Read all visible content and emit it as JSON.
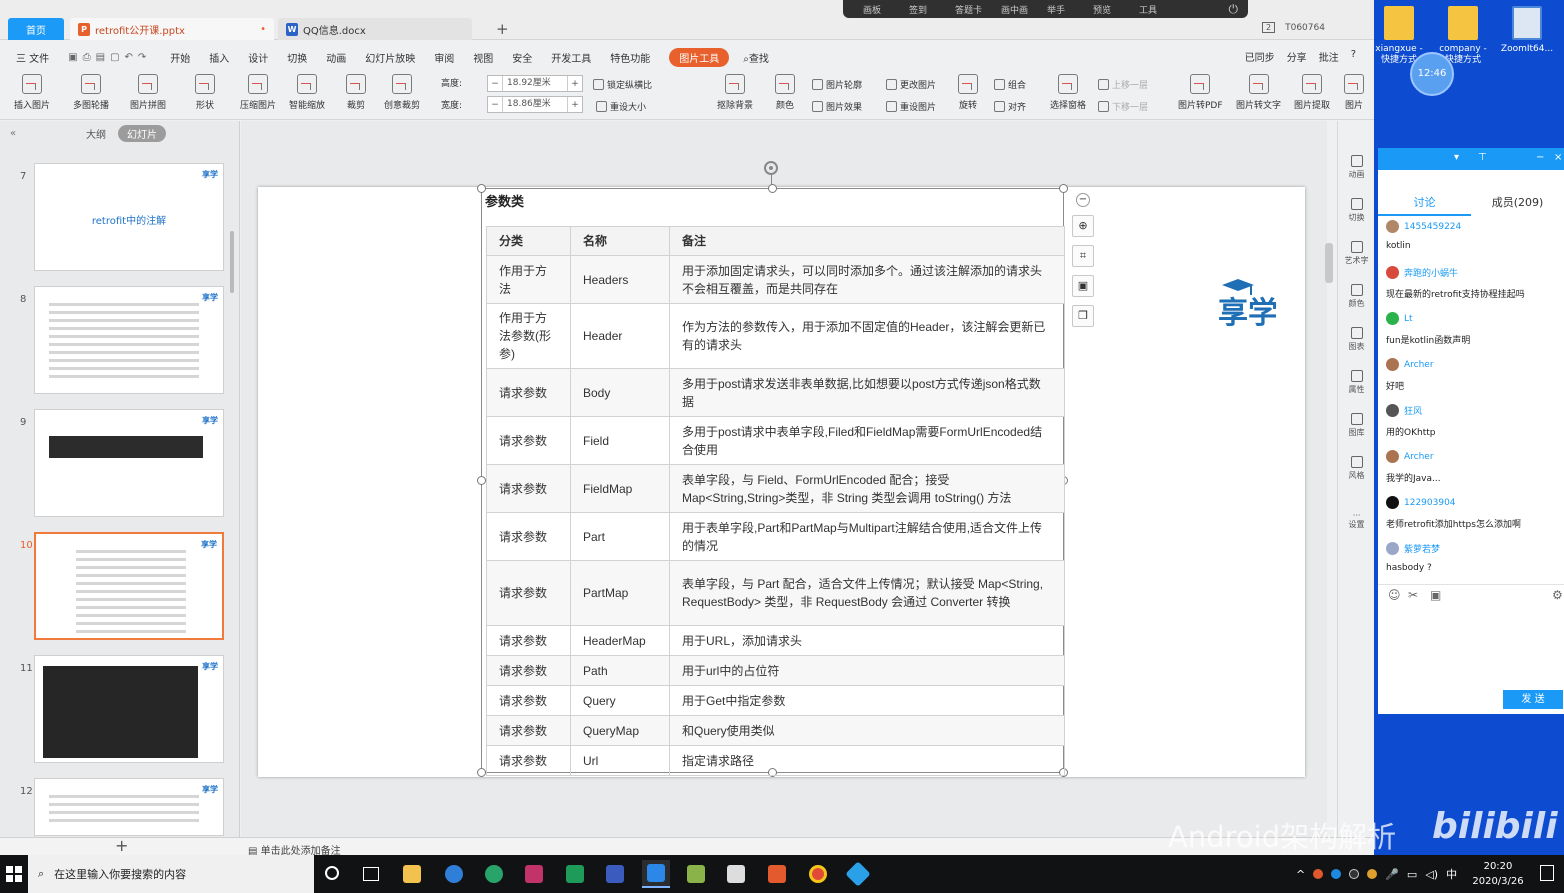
{
  "tabs": [
    {
      "label": "首页"
    },
    {
      "label": "retrofit公开课.pptx",
      "dirty": "•"
    },
    {
      "label": "QQ信息.docx"
    }
  ],
  "remote_bar": [
    "画板",
    "签到",
    "答题卡",
    "画中画",
    "举手",
    "预览",
    "工具"
  ],
  "window_controls": {
    "badge": "2",
    "user": "T060764"
  },
  "menu": {
    "file": "三 文件",
    "items": [
      "开始",
      "插入",
      "设计",
      "切换",
      "动画",
      "幻灯片放映",
      "审阅",
      "视图",
      "安全",
      "开发工具",
      "特色功能"
    ],
    "active": "图片工具",
    "search": "查找",
    "right": [
      "已同步",
      "分享",
      "批注",
      "?"
    ]
  },
  "ribbon": {
    "buttons": [
      "插入图片",
      "多图轮播",
      "图片拼图",
      "形状",
      "压缩图片",
      "智能缩放",
      "裁剪",
      "创意裁剪"
    ],
    "height_label": "高度:",
    "height_value": "18.92厘米",
    "width_label": "宽度:",
    "width_value": "18.86厘米",
    "lock_ratio": "锁定纵横比",
    "reset_size": "重设大小",
    "buttons2": [
      "抠除背景",
      "颜色"
    ],
    "small": [
      "图片轮廓",
      "更改图片",
      "图片效果",
      "重设图片"
    ],
    "buttons3": [
      "旋转",
      "选择窗格"
    ],
    "small2": [
      "组合",
      "对齐",
      "上移一层",
      "下移一层"
    ],
    "buttons4": [
      "图片转PDF",
      "图片转文字",
      "图片提取",
      "图片"
    ]
  },
  "left_pane": {
    "collapse": "«",
    "outline": "大纲",
    "slides": "幻灯片",
    "thumbs": [
      {
        "num": "7",
        "title": "retrofit中的注解"
      },
      {
        "num": "8"
      },
      {
        "num": "9"
      },
      {
        "num": "10"
      },
      {
        "num": "11"
      },
      {
        "num": "12"
      }
    ],
    "logo": "享学"
  },
  "slide": {
    "title": "参数类",
    "headers": [
      "分类",
      "名称",
      "备注"
    ],
    "rows": [
      {
        "cat": "作用于方法",
        "name": "Headers",
        "note": "用于添加固定请求头，可以同时添加多个。通过该注解添加的请求头不会相互覆盖，而是共同存在"
      },
      {
        "cat": "作用于方法参数(形参)",
        "name": "Header",
        "note": "作为方法的参数传入，用于添加不固定值的Header，该注解会更新已有的请求头"
      },
      {
        "cat": "请求参数",
        "name": "Body",
        "note": "多用于post请求发送非表单数据,比如想要以post方式传递json格式数据"
      },
      {
        "cat": "请求参数",
        "name": "Field",
        "note": "多用于post请求中表单字段,Filed和FieldMap需要FormUrlEncoded结合使用"
      },
      {
        "cat": "请求参数",
        "name": "FieldMap",
        "note": "表单字段，与 Field、FormUrlEncoded 配合；接受 Map<String,String>类型，非 String 类型会调用 toString() 方法"
      },
      {
        "cat": "请求参数",
        "name": "Part",
        "note": "用于表单字段,Part和PartMap与Multipart注解结合使用,适合文件上传的情况"
      },
      {
        "cat": "请求参数",
        "name": "PartMap",
        "note": "表单字段，与 Part 配合，适合文件上传情况；默认接受 Map<String, RequestBody> 类型，非 RequestBody 会通过 Converter 转换"
      },
      {
        "cat": "请求参数",
        "name": "HeaderMap",
        "note": "用于URL，添加请求头"
      },
      {
        "cat": "请求参数",
        "name": "Path",
        "note": "用于url中的占位符"
      },
      {
        "cat": "请求参数",
        "name": "Query",
        "note": "用于Get中指定参数"
      },
      {
        "cat": "请求参数",
        "name": "QueryMap",
        "note": "和Query使用类似"
      },
      {
        "cat": "请求参数",
        "name": "Url",
        "note": "指定请求路径"
      }
    ],
    "logo_text": "享学"
  },
  "right_pane": [
    "动画",
    "切换",
    "艺术字",
    "颜色",
    "图表",
    "属性",
    "图库",
    "风格",
    "设置"
  ],
  "notes": {
    "add": "+",
    "placeholder": "单击此处添加备注"
  },
  "desktop": {
    "icons": [
      "xiangxue - 快捷方式",
      "company - 快捷方式",
      "ZoomIt64..."
    ],
    "bubble_time": "12:46"
  },
  "chat": {
    "tabs": [
      "讨论",
      "成员(209)"
    ],
    "messages": [
      {
        "user": "1455459224",
        "text": "kotlin"
      },
      {
        "user": "奔跑的小蜗牛",
        "text": "现在最新的retrofit支持协程挂起吗"
      },
      {
        "user": "Lt",
        "text": "fun是kotlin函数声明"
      },
      {
        "user": "Archer",
        "text": "好吧"
      },
      {
        "user": "狂风",
        "text": "用的OKhttp"
      },
      {
        "user": "Archer",
        "text": "我学的Java..."
      },
      {
        "user": "122903904",
        "text": "老师retrofit添加https怎么添加啊"
      },
      {
        "user": "紫萝若梦",
        "text": "hasbody ?"
      }
    ],
    "send": "发 送"
  },
  "watermark": {
    "text": "Android架构解析",
    "brand": "bilibili"
  },
  "taskbar": {
    "search_placeholder": "在这里输入你要搜索的内容",
    "tray_lang": "中",
    "time": "20:20",
    "date": "2020/3/26"
  }
}
